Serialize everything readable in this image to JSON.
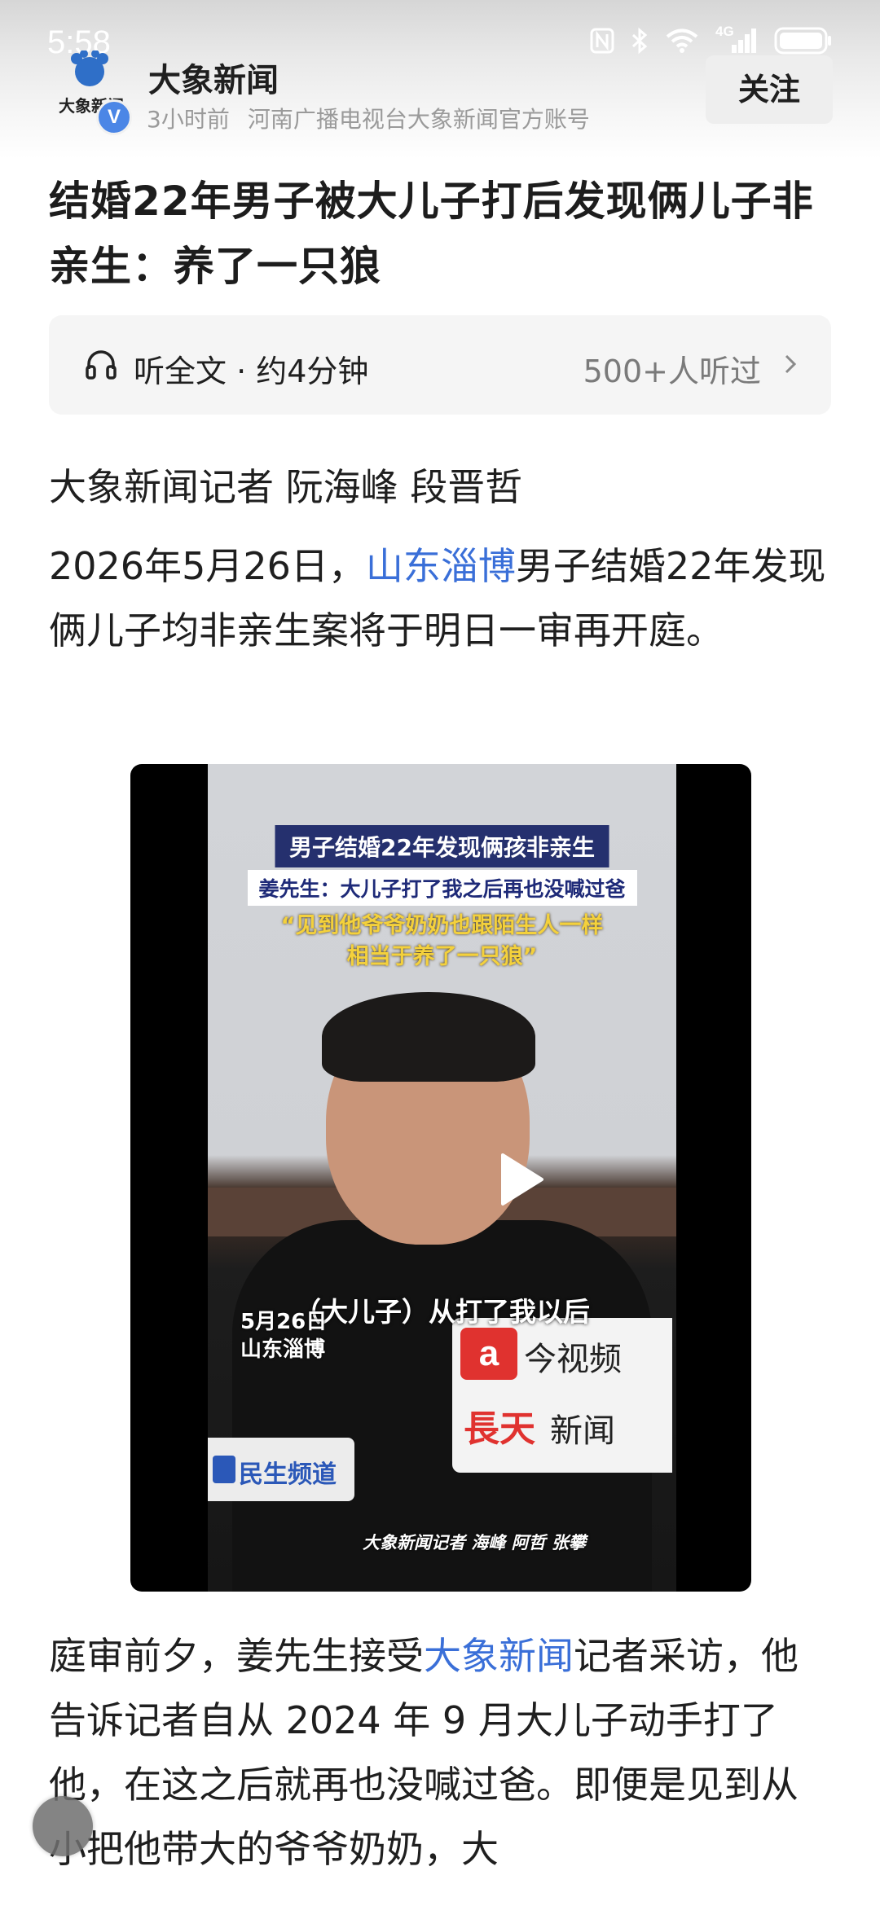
{
  "status_bar": {
    "time": "5:58",
    "network": "4G"
  },
  "account": {
    "logo_text": "大象新闻",
    "verified_mark": "V",
    "name": "大象新闻",
    "time_ago": "3小时前",
    "description": "河南广播电视台大象新闻官方账号",
    "follow_label": "关注"
  },
  "article": {
    "title": "结婚22年男子被大儿子打后发现俩儿子非亲生：养了一只狼",
    "listen": {
      "label": "听全文 · 约4分钟",
      "count": "500+人听过"
    },
    "byline": "大象新闻记者 阮海峰 段晋哲",
    "para1": {
      "before": "2026年5月26日，",
      "link": "山东淄博",
      "after": "男子结婚22年发现俩儿子均非亲生案将于明日一审再开庭。"
    },
    "para2": {
      "before": "庭审前夕，姜先生接受",
      "link": "大象新闻",
      "after": "记者采访，他告诉记者自从 2024 年 9 月大儿子动手打了他，在这之后就再也没喊过爸。即便是见到从小把他带大的爷爷奶奶，大"
    }
  },
  "video": {
    "overlay_title": "男子结婚22年发现俩孩非亲生",
    "overlay_sub": "姜先生：大儿子打了我之后再也没喊过爸",
    "overlay_quote_1": "“见到他爷爷奶奶也跟陌生人一样",
    "overlay_quote_2": "相当于养了一只狼”",
    "subtitle": "（大儿子）从打了我以后",
    "date_line1": "5月26日",
    "date_line2": "山东淄博",
    "channel": "民生频道",
    "mic_logo": "a",
    "mic_brand_top": "今视频",
    "mic_brand_red": "長天",
    "mic_brand_bottom": "新闻",
    "credit": "大象新闻记者 海峰 阿哲 张攀"
  },
  "colors": {
    "link": "#3a6fd8",
    "verified": "#4b86e6",
    "overlay_title_bg": "#25306e",
    "overlay_quote": "#f4d13c"
  },
  "icons": {
    "headphones": "headphones-icon",
    "chevron": "chevron-right-icon",
    "play": "play-icon",
    "wifi": "wifi-icon",
    "bluetooth": "bluetooth-icon",
    "nfc": "nfc-icon",
    "battery": "battery-icon",
    "signal": "signal-icon"
  }
}
